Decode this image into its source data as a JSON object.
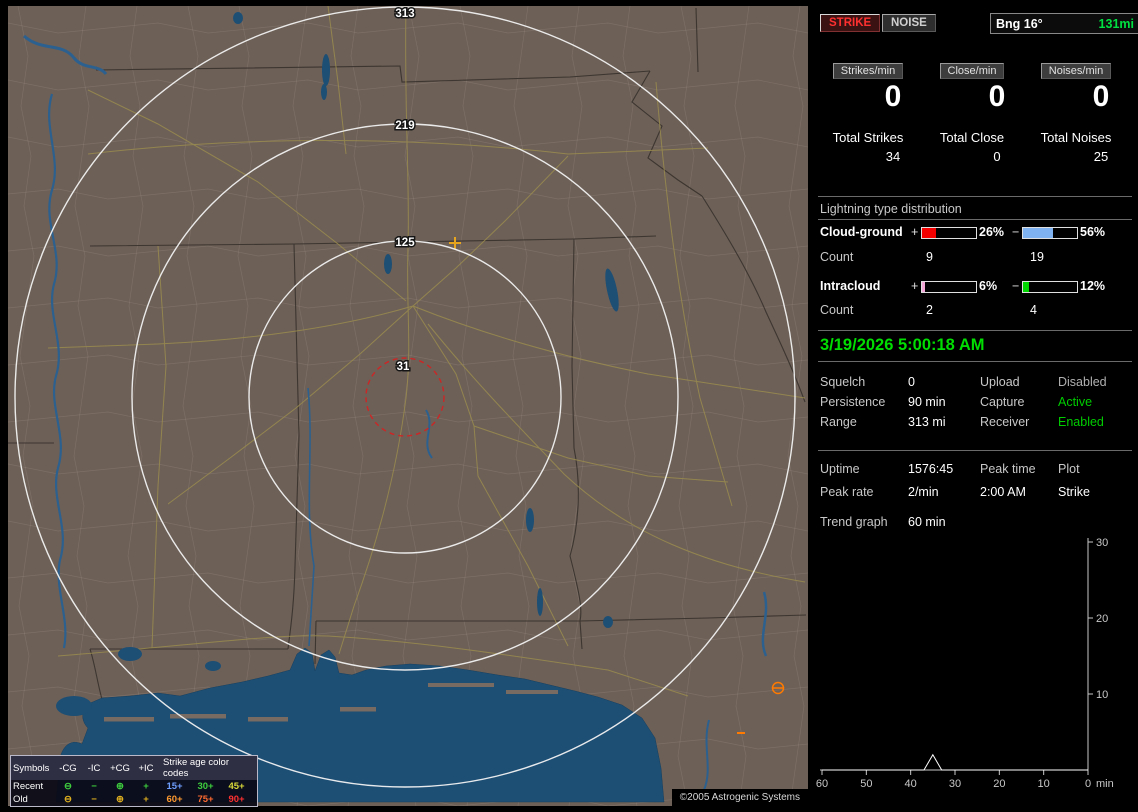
{
  "map": {
    "ring_labels": {
      "r313": "313",
      "r219": "219",
      "r125": "125",
      "r31": "31"
    },
    "copyright": "©2005 Astrogenic Systems",
    "colors": {
      "land": "#6d6057",
      "water": "#1d4e74",
      "ring": "#f2f2f2",
      "close_ring": "#cc2626",
      "road": "#9a8c4e"
    }
  },
  "legend": {
    "symbols_title": "Symbols",
    "symbol_cols": [
      "-CG",
      "-IC",
      "+CG",
      "+IC"
    ],
    "age_title": "Strike age color codes",
    "rows": [
      {
        "label": "Recent",
        "symbol_color": "#3ecf3e",
        "symbols": [
          "⊖",
          "−",
          "⊕",
          "+"
        ],
        "ages": [
          {
            "text": "15+",
            "color": "#6f9fff"
          },
          {
            "text": "30+",
            "color": "#3ecf3e"
          },
          {
            "text": "45+",
            "color": "#d8d83a"
          }
        ]
      },
      {
        "label": "Old",
        "symbol_color": "#e0b020",
        "symbols": [
          "⊖",
          "−",
          "⊕",
          "+"
        ],
        "ages": [
          {
            "text": "60+",
            "color": "#ff9a30"
          },
          {
            "text": "75+",
            "color": "#ff6a30"
          },
          {
            "text": "90+",
            "color": "#ff3030"
          }
        ]
      }
    ]
  },
  "panel": {
    "modes": [
      {
        "label": "STRIKE"
      },
      {
        "label": "NOISE"
      }
    ],
    "bearing": {
      "label": "Bng 16°",
      "value": "131mi"
    },
    "rates": [
      {
        "label": "Strikes/min",
        "value": "0",
        "total_label": "Total Strikes",
        "total": "34"
      },
      {
        "label": "Close/min",
        "value": "0",
        "total_label": "Total Close",
        "total": "0"
      },
      {
        "label": "Noises/min",
        "value": "0",
        "total_label": "Total Noises",
        "total": "25"
      }
    ],
    "distribution": {
      "title": "Lightning type distribution",
      "rows": [
        {
          "label": "Cloud-ground",
          "plus_sign": "+",
          "minus_sign": "−",
          "plus": {
            "pct": 26,
            "color": "#f20000"
          },
          "plus_label": "26%",
          "minus": {
            "pct": 56,
            "color": "#7fb2f0"
          },
          "minus_label": "56%",
          "count_label": "Count",
          "plus_count": "9",
          "minus_count": "19"
        },
        {
          "label": "Intracloud",
          "plus_sign": "+",
          "minus_sign": "−",
          "plus": {
            "pct": 6,
            "color": "#f2a6d8"
          },
          "plus_label": "6%",
          "minus": {
            "pct": 12,
            "color": "#00d400"
          },
          "minus_label": "12%",
          "count_label": "Count",
          "plus_count": "2",
          "minus_count": "4"
        }
      ]
    },
    "timestamp": "3/19/2026 5:00:18 AM",
    "settings": [
      {
        "label": "Squelch",
        "value": "0",
        "color": "#ffffff"
      },
      {
        "label": "Upload",
        "value": "Disabled",
        "color": "#b0b0b0"
      },
      {
        "label": "Persistence",
        "value": "90 min",
        "color": "#ffffff"
      },
      {
        "label": "Capture",
        "value": "Active",
        "color": "#00cc00"
      },
      {
        "label": "Range",
        "value": "313 mi",
        "color": "#ffffff"
      },
      {
        "label": "Receiver",
        "value": "Enabled",
        "color": "#00cc00"
      }
    ],
    "stats": {
      "uptime_label": "Uptime",
      "uptime": "1576:45",
      "peak_time_label": "Peak time",
      "peak_time": "2:00 AM",
      "plot_label": "Plot",
      "plot": "Strike",
      "peak_rate_label": "Peak rate",
      "peak_rate": "2/min",
      "trend_label": "Trend graph",
      "trend_window": "60 min"
    }
  },
  "chart_data": {
    "type": "line",
    "title": "Trend graph (strikes per minute, last 60 min)",
    "series": [
      {
        "name": "Strike rate",
        "points": [
          [
            60,
            0
          ],
          [
            37,
            0
          ],
          [
            35,
            2
          ],
          [
            33,
            0
          ],
          [
            0,
            0
          ]
        ]
      }
    ],
    "x_ticks": [
      60,
      50,
      40,
      30,
      20,
      10,
      0
    ],
    "y_ticks": [
      30,
      20,
      10
    ],
    "xlim": [
      60,
      0
    ],
    "ylim": [
      0,
      30
    ],
    "xlabel": "min",
    "ylabel": "",
    "grid": false,
    "legend_position": "none",
    "line_color": "#ffffff",
    "axis_color": "#c8c8c8"
  }
}
